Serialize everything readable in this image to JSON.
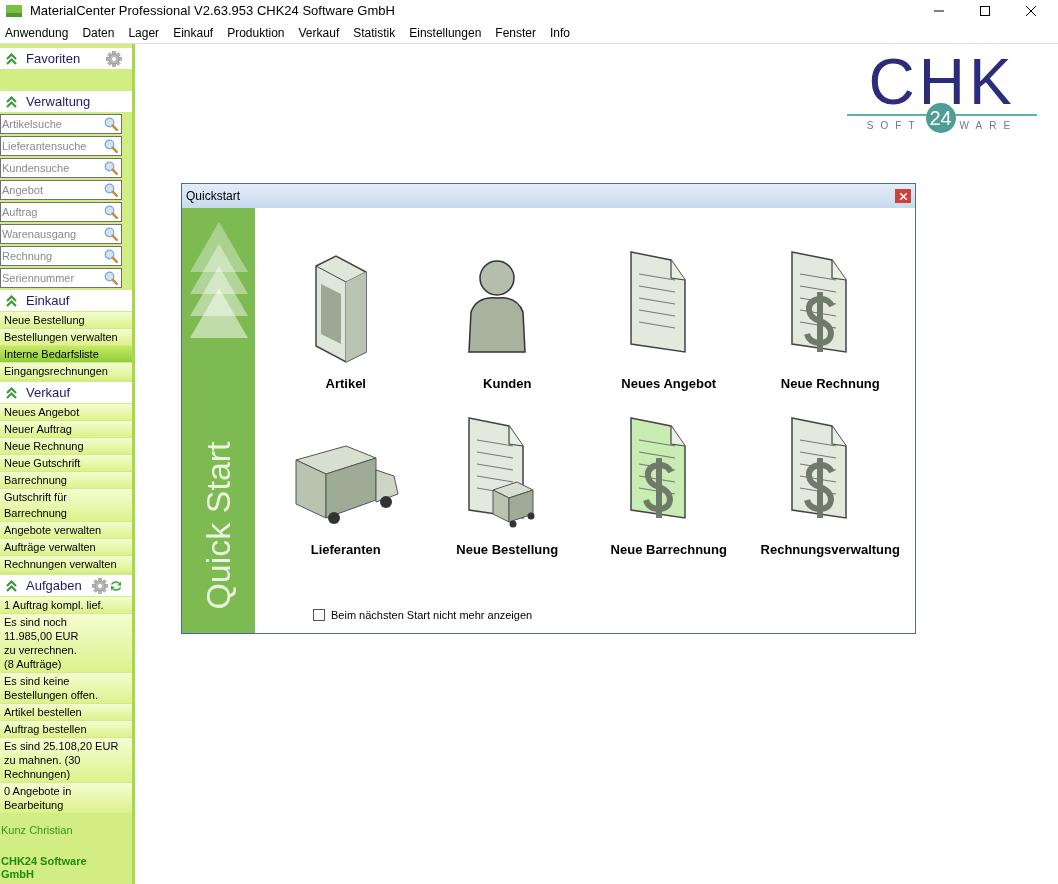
{
  "window": {
    "title": "MaterialCenter Professional V2.63.953   CHK24 Software GmbH"
  },
  "menu": [
    "Anwendung",
    "Daten",
    "Lager",
    "Einkauf",
    "Produktion",
    "Verkauf",
    "Statistik",
    "Einstellungen",
    "Fenster",
    "Info"
  ],
  "sidebar": {
    "sections": [
      {
        "kind": "favorites",
        "title": "Favoriten"
      },
      {
        "kind": "search",
        "title": "Verwaltung",
        "items": [
          {
            "placeholder": "Artikelsuche"
          },
          {
            "placeholder": "Lieferantensuche"
          },
          {
            "placeholder": "Kundensuche"
          },
          {
            "placeholder": "Angebot"
          },
          {
            "placeholder": "Auftrag"
          },
          {
            "placeholder": "Warenausgang"
          },
          {
            "placeholder": "Rechnung"
          },
          {
            "placeholder": "Seriennummer"
          }
        ]
      },
      {
        "kind": "links",
        "title": "Einkauf",
        "items": [
          {
            "label": "Neue Bestellung",
            "selected": false
          },
          {
            "label": "Bestellungen verwalten",
            "selected": false
          },
          {
            "label": "Interne Bedarfsliste",
            "selected": true
          },
          {
            "label": "Eingangsrechnungen",
            "selected": false
          }
        ]
      },
      {
        "kind": "links",
        "title": "Verkauf",
        "items": [
          {
            "label": "Neues Angebot",
            "selected": false
          },
          {
            "label": "Neuer Auftrag",
            "selected": false
          },
          {
            "label": "Neue Rechnung",
            "selected": false
          },
          {
            "label": "Neue Gutschrift",
            "selected": false
          },
          {
            "label": "Barrechnung",
            "selected": false
          },
          {
            "label": "Gutschrift für Barrechnung",
            "selected": false
          },
          {
            "label": "Angebote verwalten",
            "selected": false
          },
          {
            "label": "Aufträge verwalten",
            "selected": false
          },
          {
            "label": "Rechnungen verwalten",
            "selected": false
          }
        ]
      },
      {
        "kind": "tasks",
        "title": "Aufgaben",
        "items": [
          {
            "label": "1 Auftrag kompl. lief.",
            "selected": false
          },
          {
            "label": "Es sind noch\n11.985,00 EUR\nzu verrechnen.\n(8 Aufträge)",
            "selected": false
          },
          {
            "label": "Es sind keine\nBestellungen offen.",
            "selected": false
          },
          {
            "label": "Artikel bestellen",
            "selected": false
          },
          {
            "label": "Auftrag bestellen",
            "selected": false
          },
          {
            "label": "Es sind 25.108,20 EUR\nzu mahnen. (30\nRechnungen)",
            "selected": false
          },
          {
            "label": "0 Angebote in\nBearbeitung",
            "selected": false
          }
        ]
      }
    ],
    "user": "Kunz Christian",
    "company": "CHK24 Software\nGmbH"
  },
  "logo": {
    "letters": "CHK",
    "left": "SOFT",
    "number": "24",
    "right": "WARE"
  },
  "dialog": {
    "title": "Quickstart",
    "banner": "Quick Start",
    "tiles": [
      {
        "kind": "box",
        "label": "Artikel"
      },
      {
        "kind": "person",
        "label": "Kunden"
      },
      {
        "kind": "document",
        "label": "Neues Angebot"
      },
      {
        "kind": "invoice",
        "label": "Neue Rechnung"
      },
      {
        "kind": "truck",
        "label": "Lieferanten"
      },
      {
        "kind": "order",
        "label": "Neue Bestellung"
      },
      {
        "kind": "cash",
        "label": "Neue Barrechnung"
      },
      {
        "kind": "invoice",
        "label": "Rechnungsverwaltung"
      }
    ],
    "checkbox": {
      "label": "Beim nächsten Start nicht mehr anzeigen",
      "checked": false
    }
  }
}
